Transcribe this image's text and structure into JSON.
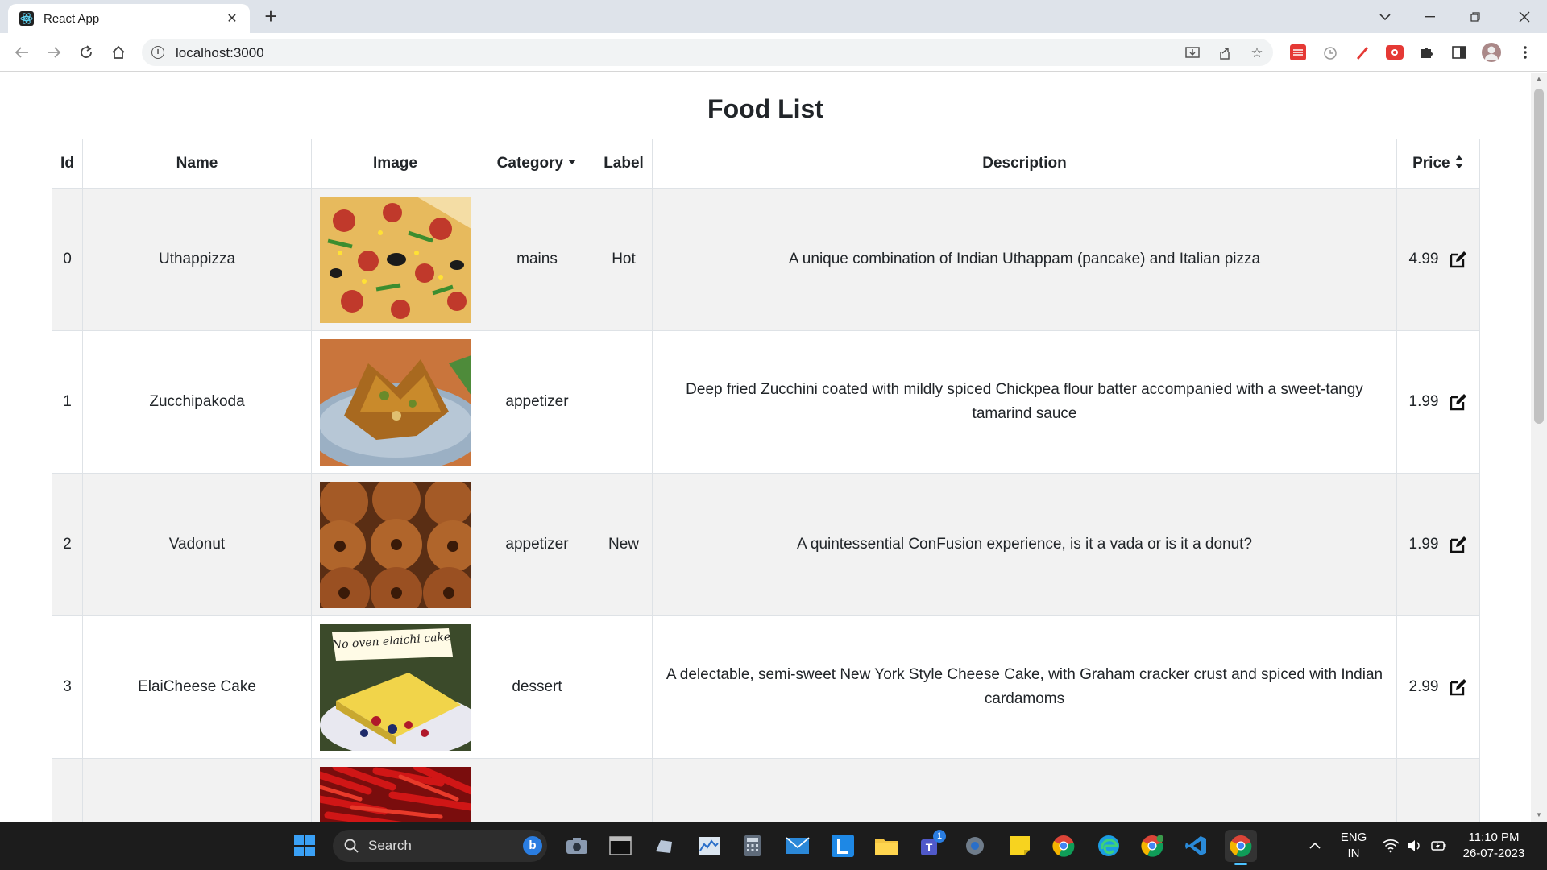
{
  "browser": {
    "tab_title": "React App",
    "tab_close": "✕",
    "new_tab": "+",
    "url": "localhost:3000"
  },
  "page": {
    "title": "Food List"
  },
  "table": {
    "headers": {
      "id": "Id",
      "name": "Name",
      "image": "Image",
      "category": "Category",
      "label": "Label",
      "description": "Description",
      "price": "Price"
    },
    "rows": [
      {
        "id": "0",
        "name": "Uthappizza",
        "image": "pizza",
        "category": "mains",
        "label": "Hot",
        "description": "A unique combination of Indian Uthappam (pancake) and Italian pizza",
        "price": "4.99"
      },
      {
        "id": "1",
        "name": "Zucchipakoda",
        "image": "pakoda",
        "category": "appetizer",
        "label": "",
        "description": "Deep fried Zucchini coated with mildly spiced Chickpea flour batter accompanied with a sweet-tangy tamarind sauce",
        "price": "1.99"
      },
      {
        "id": "2",
        "name": "Vadonut",
        "image": "vadonut",
        "category": "appetizer",
        "label": "New",
        "description": "A quintessential ConFusion experience, is it a vada or is it a donut?",
        "price": "1.99"
      },
      {
        "id": "3",
        "name": "ElaiCheese Cake",
        "image": "cheesecake",
        "category": "dessert",
        "label": "",
        "description": "A delectable, semi-sweet New York Style Cheese Cake, with Graham cracker crust and spiced with Indian cardamoms",
        "price": "2.99"
      }
    ],
    "image_caption": "No oven elaichi cake"
  },
  "taskbar": {
    "search_label": "Search",
    "teams_badge": "1",
    "language": "ENG",
    "region": "IN",
    "time": "11:10 PM",
    "date": "26-07-2023"
  },
  "colors": {
    "accent": "#0d6efd",
    "stripe": "#f2f2f2",
    "border": "#dee2e6"
  }
}
